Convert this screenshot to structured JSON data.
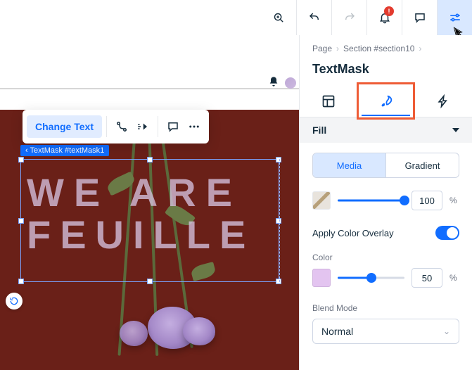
{
  "topbar": {
    "notification_count": "!"
  },
  "canvas": {
    "selection_label": "TextMask #textMask1",
    "mask_text_line1": "WE ARE",
    "mask_text_line2": "FEUILLE",
    "toolbar": {
      "change_text": "Change Text"
    }
  },
  "panel": {
    "breadcrumb": {
      "page": "Page",
      "section": "Section #section10"
    },
    "title": "TextMask",
    "section_fill": "Fill",
    "fill_mode": {
      "media": "Media",
      "gradient": "Gradient"
    },
    "opacity": {
      "value": "100",
      "unit": "%"
    },
    "apply_overlay_label": "Apply Color Overlay",
    "color_label": "Color",
    "color_opacity": {
      "value": "50",
      "unit": "%"
    },
    "blend_label": "Blend Mode",
    "blend_value": "Normal"
  }
}
